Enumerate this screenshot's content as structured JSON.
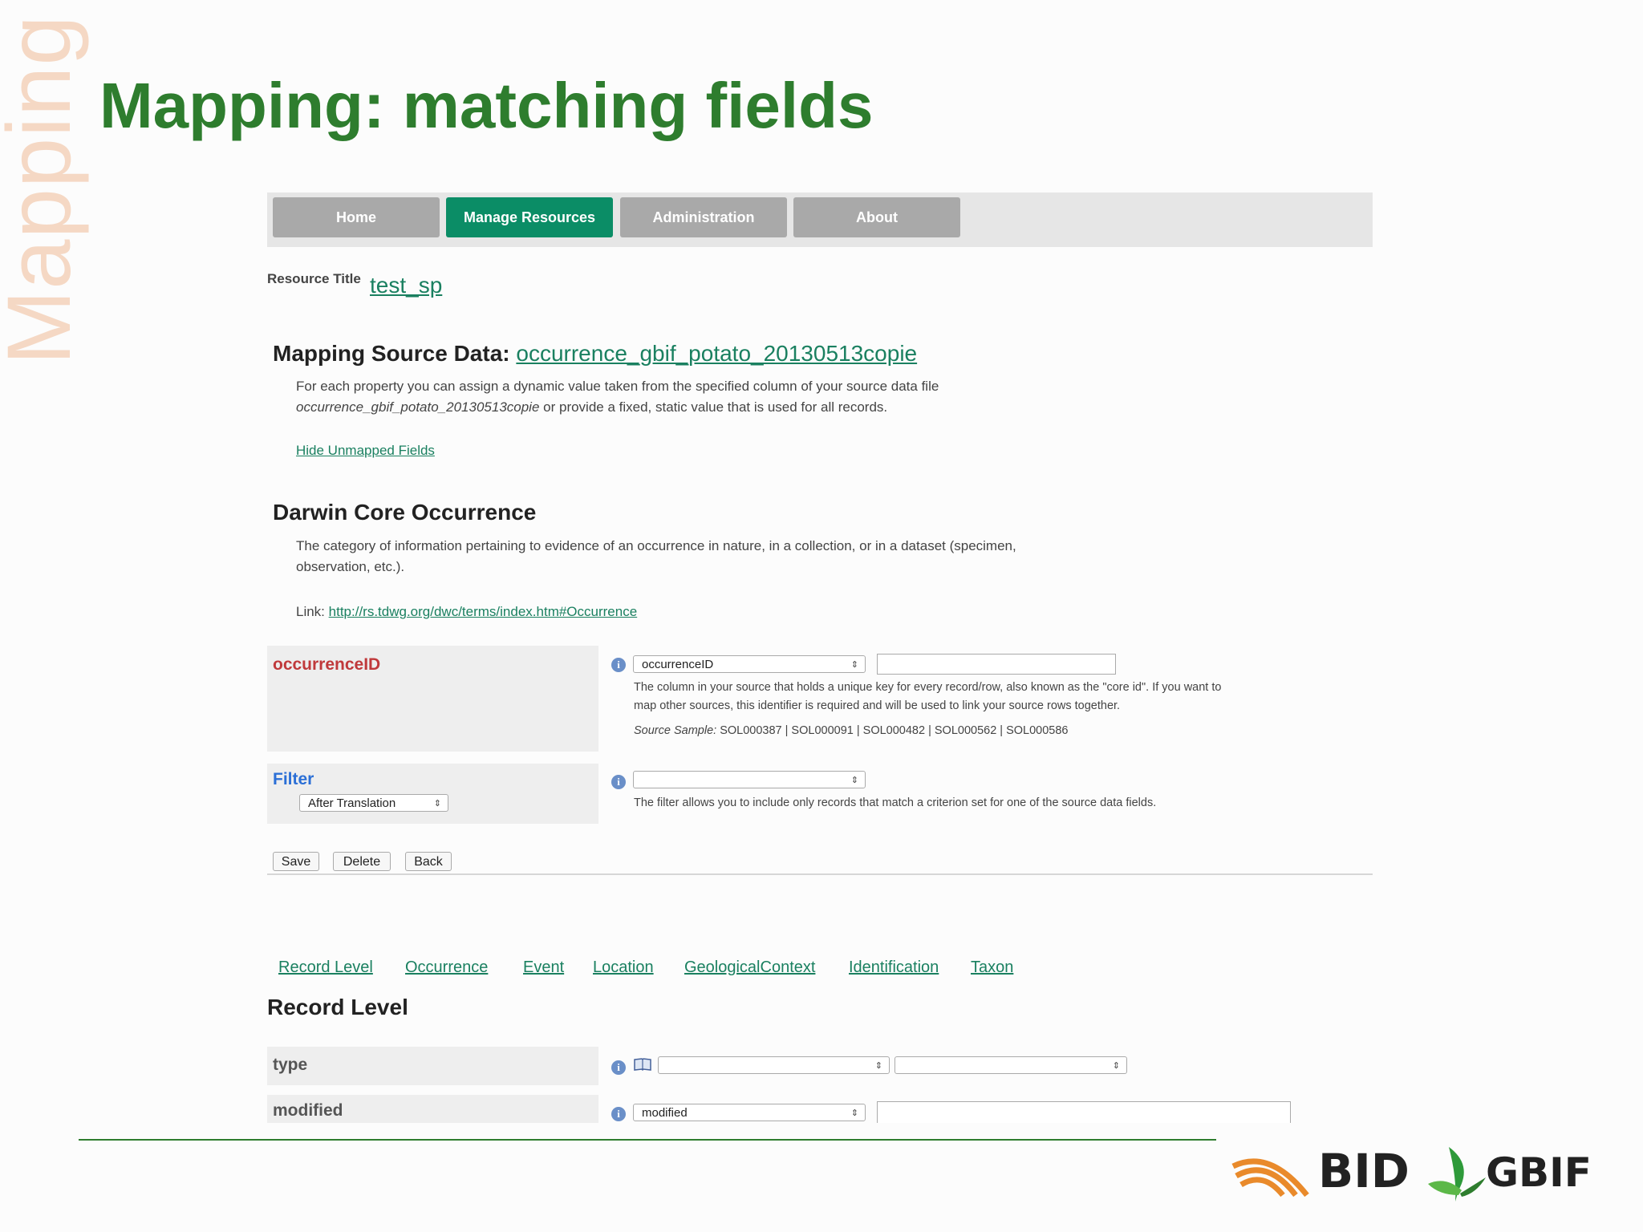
{
  "slide": {
    "side_label": "Mapping",
    "title": "Mapping: matching fields"
  },
  "nav": {
    "items": [
      {
        "label": "Home",
        "active": false
      },
      {
        "label": "Manage Resources",
        "active": true
      },
      {
        "label": "Administration",
        "active": false
      },
      {
        "label": "About",
        "active": false
      }
    ]
  },
  "resource": {
    "title_label": "Resource Title",
    "title_value": "test_sp"
  },
  "mapping": {
    "heading_prefix": "Mapping Source Data:",
    "source_file": "occurrence_gbif_potato_20130513copie",
    "desc_line1": "For each property you can assign a dynamic value taken from the specified column of your source data file",
    "desc_line2_file": "occurrence_gbif_potato_20130513copie",
    "desc_line2_rest": " or provide a fixed, static value that is used for all records.",
    "hide_link": "Hide Unmapped Fields"
  },
  "dwc": {
    "heading": "Darwin Core Occurrence",
    "desc_line1": "The category of information pertaining to evidence of an occurrence in nature, in a collection, or in a dataset (specimen,",
    "desc_line2": "observation, etc.).",
    "link_label": "Link: ",
    "link_url": "http://rs.tdwg.org/dwc/terms/index.htm#Occurrence"
  },
  "occurrence_id": {
    "name": "occurrenceID",
    "select_value": "occurrenceID",
    "desc_line1": "The column in your source that holds a unique key for every record/row, also known as the \"core id\". If you want to",
    "desc_line2": "map other sources, this identifier is required and will be used to link your source rows together.",
    "sample_label": "Source Sample:",
    "sample_values": " SOL000387 | SOL000091 | SOL000482 | SOL000562 | SOL000586"
  },
  "filter": {
    "name": "Filter",
    "mode": "After Translation",
    "select_value": "",
    "desc": "The filter allows you to include only records that match a criterion set for one of the source data fields."
  },
  "buttons": {
    "save": "Save",
    "delete": "Delete",
    "back": "Back"
  },
  "tabs": [
    "Record Level",
    "Occurrence",
    "Event",
    "Location",
    "GeologicalContext",
    "Identification",
    "Taxon"
  ],
  "record_level": {
    "heading": "Record Level",
    "rows": [
      {
        "name": "type",
        "select_value": "",
        "second_select": ""
      },
      {
        "name": "modified",
        "select_value": "modified"
      }
    ]
  },
  "icons": {
    "info": "info-icon",
    "vocabulary": "book-icon",
    "select_arrow": "updown-arrows-icon"
  },
  "logos": {
    "bid": "BID",
    "gbif": "GBIF"
  },
  "colors": {
    "title_green": "#2e7d2e",
    "nav_active": "#0b8d66",
    "nav_inactive": "#a9a9a9",
    "link_green": "#1a8060",
    "required_red": "#c0393b",
    "filter_blue": "#2b6fd6",
    "bid_orange": "#e98a2b",
    "side_label": "#f5d8c4"
  }
}
